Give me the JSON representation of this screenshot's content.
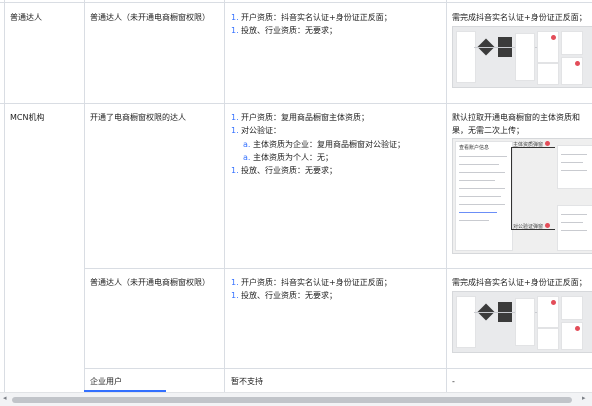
{
  "rows": [
    {
      "col1": "普通达人",
      "col2": "普通达人（未开通电商橱窗权限）",
      "items": [
        {
          "n": "1.",
          "t": "开户资质：抖音实名认证+身份证正反面；"
        },
        {
          "n": "1.",
          "t": "投放、行业资质：无要求；"
        }
      ],
      "col4": "需完成抖音实名认证+身份证正反面；"
    },
    {
      "col1": "MCN机构",
      "col2": "开通了电商橱窗权限的达人",
      "items": [
        {
          "n": "1.",
          "t": "开户资质：复用商品橱窗主体资质；"
        },
        {
          "n": "1.",
          "t": "对公验证："
        },
        {
          "n": "a.",
          "t": "主体资质为企业：复用商品橱窗对公验证；",
          "sub": true
        },
        {
          "n": "a.",
          "t": "主体资质为个人：无；",
          "sub": true
        },
        {
          "n": "1.",
          "t": "投放、行业资质：无要求；"
        }
      ],
      "col4_lines": [
        "默认拉取开通电商橱窗的主体资质和",
        "果，无需二次上传；"
      ],
      "thumb": {
        "title": "查看账户信息",
        "label_top": "主体资质弹窗",
        "label_bottom": "对公验证弹窗"
      }
    },
    {
      "col1": "",
      "col2": "普通达人（未开通电商橱窗权限）",
      "items": [
        {
          "n": "1.",
          "t": "开户资质：抖音实名认证+身份证正反面；"
        },
        {
          "n": "1.",
          "t": "投放、行业资质：无要求；"
        }
      ],
      "col4": "需完成抖音实名认证+身份证正反面；"
    },
    {
      "col1": "",
      "col2": "企业用户",
      "col3": "暂不支持",
      "col4": "-"
    }
  ],
  "scroll": {
    "left_arrow": "◂",
    "right_arrow": "▸"
  }
}
